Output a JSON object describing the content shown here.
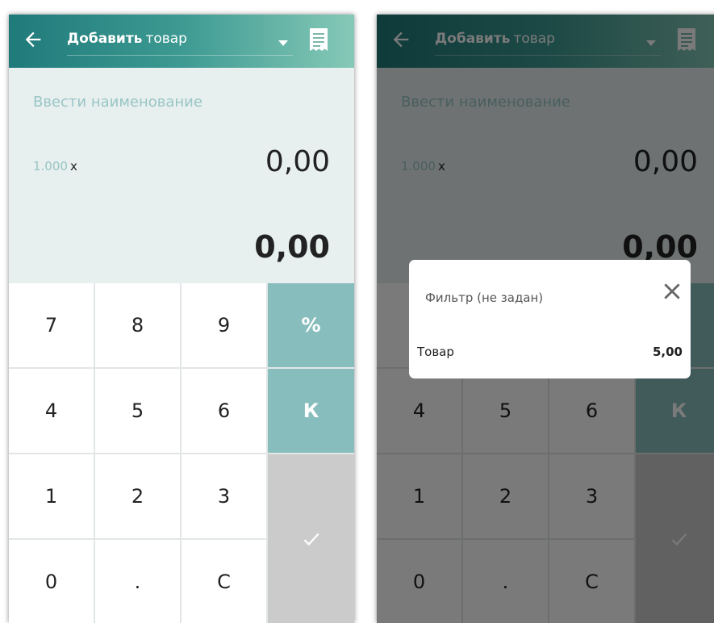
{
  "appbar": {
    "title_bold": "Добавить",
    "title_regular": "товар",
    "back_icon": "arrow-left-icon",
    "menu_icon": "receipt-icon"
  },
  "entry": {
    "name_placeholder": "Ввести наименование",
    "quantity": "1.000",
    "multiply_sign": "x",
    "price": "0,00",
    "total": "0,00"
  },
  "keypad": {
    "keys": [
      "7",
      "8",
      "9",
      "%",
      "4",
      "5",
      "6",
      "К",
      "1",
      "2",
      "3",
      "0",
      ".",
      "С"
    ],
    "confirm_icon": "check-icon"
  },
  "popup": {
    "filter_label": "Фильтр (не задан)",
    "close_icon": "close-icon",
    "item_name": "Товар",
    "item_value": "5,00"
  },
  "colors": {
    "accent": "#2b8585",
    "teal_key": "#88bdbd",
    "placeholder": "#99c5c5"
  }
}
